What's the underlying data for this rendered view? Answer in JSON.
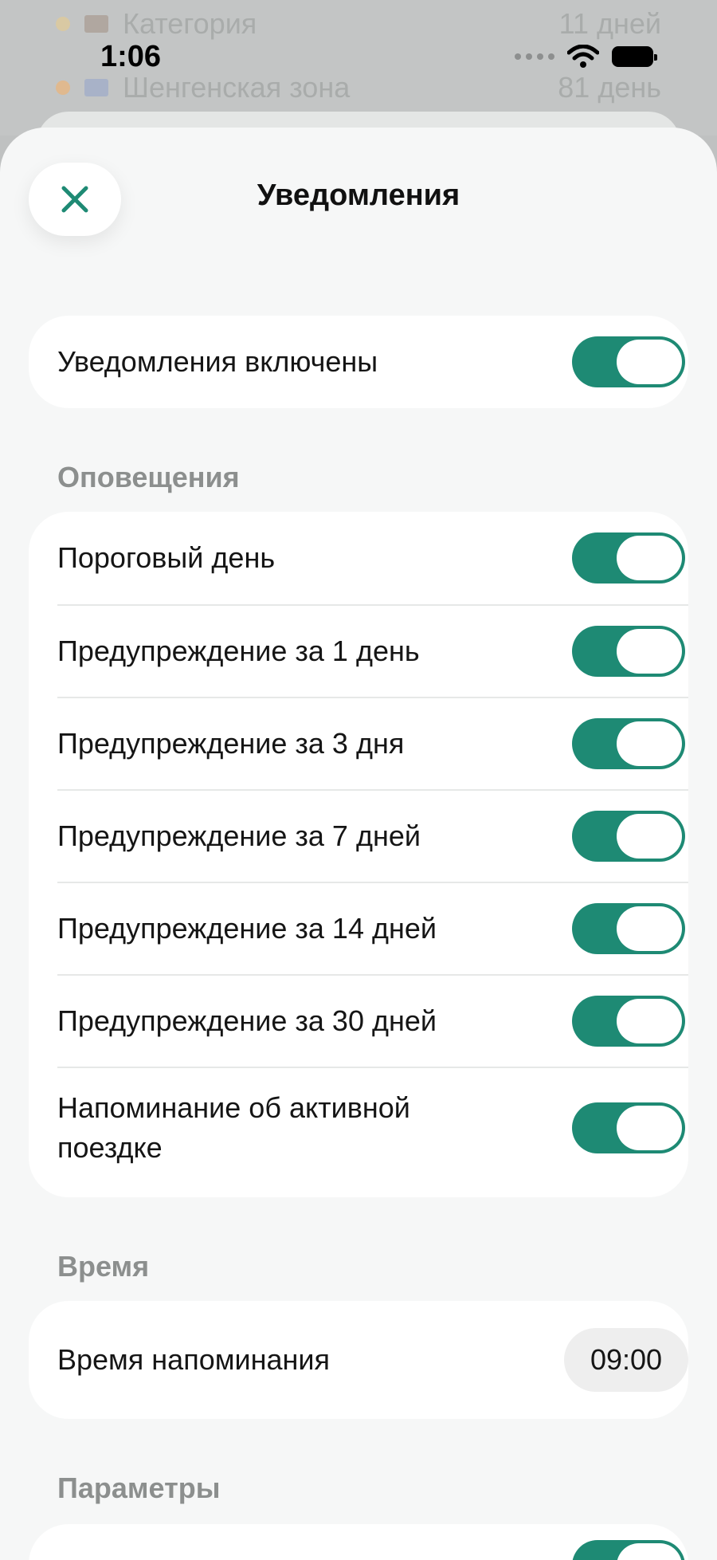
{
  "status_bar": {
    "time": "1:06"
  },
  "backdrop": {
    "row1_label": "Категория",
    "row1_value": "11 дней",
    "row2_label": "Шенгенская зона",
    "row2_value": "81 день"
  },
  "header": {
    "title": "Уведомления",
    "close_icon": "close-icon"
  },
  "master": {
    "label": "Уведомления включены",
    "enabled": true
  },
  "alerts": {
    "section_title": "Оповещения",
    "items": [
      {
        "label": "Пороговый день",
        "enabled": true
      },
      {
        "label": "Предупреждение за 1 день",
        "enabled": true
      },
      {
        "label": "Предупреждение за 3 дня",
        "enabled": true
      },
      {
        "label": "Предупреждение за 7 дней",
        "enabled": true
      },
      {
        "label": "Предупреждение за 14 дней",
        "enabled": true
      },
      {
        "label": "Предупреждение за 30 дней",
        "enabled": true
      },
      {
        "label": "Напоминание об активной поездке",
        "enabled": true
      }
    ]
  },
  "time": {
    "section_title": "Время",
    "label": "Время напоминания",
    "value": "09:00"
  },
  "params": {
    "section_title": "Параметры"
  },
  "colors": {
    "accent": "#1e8a74",
    "background": "#f6f7f7",
    "card": "#ffffff",
    "section_text": "#8c8f8e"
  }
}
